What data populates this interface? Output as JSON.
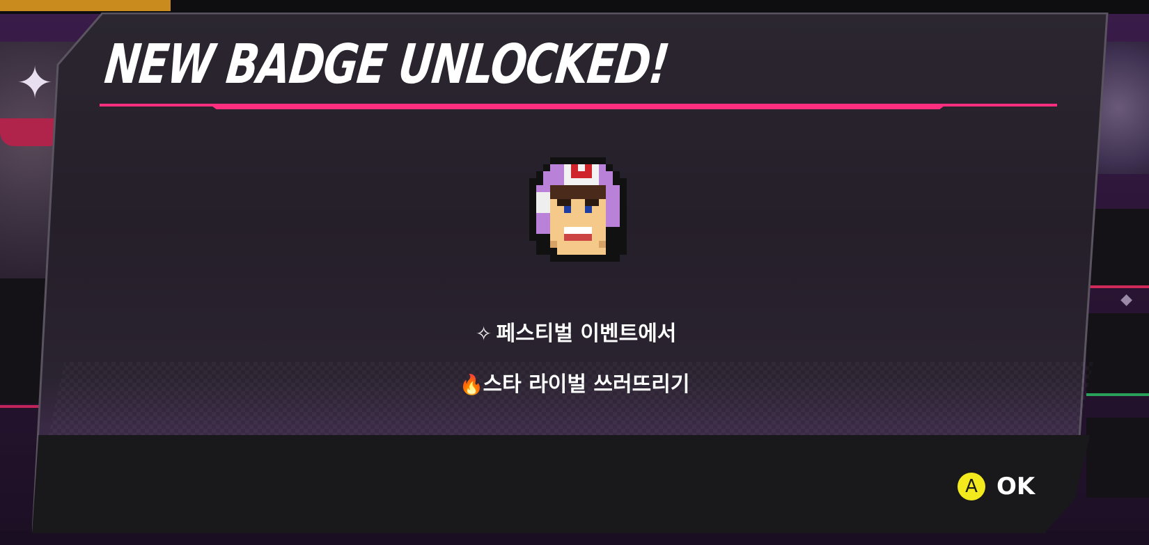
{
  "dialog": {
    "title": "NEW BADGE UNLOCKED!",
    "badge_icon": "helmet-wrestler-pixel-face",
    "lines": [
      {
        "icon": "sparkle-icon",
        "icon_glyph": "✧",
        "text": "페스티벌 이벤트에서"
      },
      {
        "icon": "flame-icon",
        "icon_glyph": "🔥",
        "text": "스타 라이벌 쓰러뜨리기"
      }
    ]
  },
  "footer": {
    "confirm_button_glyph": "A",
    "confirm_label": "OK"
  },
  "colors": {
    "accent_pink": "#ff2e7e",
    "button_yellow": "#f2ea1c",
    "topbar_gold": "#c98a1e"
  }
}
